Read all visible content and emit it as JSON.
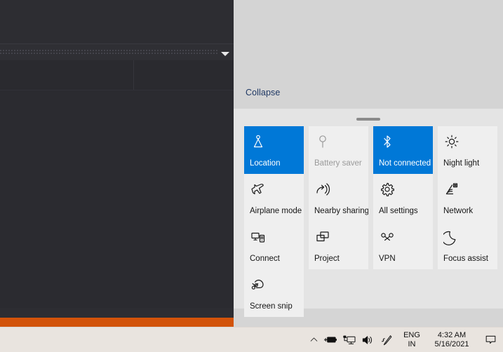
{
  "app_window": {
    "name": "background-application-window",
    "accent_color": "#d2530a",
    "background_color": "#2b2b30",
    "dropdown_icon": "chevron-down-icon"
  },
  "action_center": {
    "panel_background": "#d5d5d5",
    "notifications": {
      "items": [],
      "collapse_label": "Collapse"
    },
    "drag_handle": "resize-grip",
    "tiles": [
      {
        "label": "Location",
        "icon": "location-icon",
        "state": "on"
      },
      {
        "label": "Battery saver",
        "icon": "battery-saver-icon",
        "state": "disabled"
      },
      {
        "label": "Not connected",
        "icon": "bluetooth-icon",
        "state": "on"
      },
      {
        "label": "Night light",
        "icon": "brightness-sun-icon",
        "state": "off"
      },
      {
        "label": "Airplane mode",
        "icon": "airplane-icon",
        "state": "off"
      },
      {
        "label": "Nearby sharing",
        "icon": "nearby-sharing-icon",
        "state": "off"
      },
      {
        "label": "All settings",
        "icon": "gear-icon",
        "state": "off"
      },
      {
        "label": "Network",
        "icon": "wifi-icon",
        "state": "off"
      },
      {
        "label": "Connect",
        "icon": "connect-icon",
        "state": "off"
      },
      {
        "label": "Project",
        "icon": "project-icon",
        "state": "off"
      },
      {
        "label": "VPN",
        "icon": "vpn-icon",
        "state": "off"
      },
      {
        "label": "Focus assist",
        "icon": "moon-icon",
        "state": "off"
      },
      {
        "label": "Screen snip",
        "icon": "screen-snip-icon",
        "state": "off"
      }
    ],
    "accent_color": "#0078d7",
    "link_color": "#1f3864"
  },
  "taskbar": {
    "background_color": "#e9e4df",
    "tray": {
      "show_hidden_icons": "chevron-up-icon",
      "battery": "battery-charging-icon",
      "network": "network-monitor-icon",
      "volume": "speaker-icon",
      "pen": "pen-workspace-icon",
      "language": {
        "line1": "ENG",
        "line2": "IN"
      },
      "clock": {
        "time": "4:32 AM",
        "date": "5/16/2021"
      },
      "action_center": "notification-balloon-icon"
    }
  }
}
